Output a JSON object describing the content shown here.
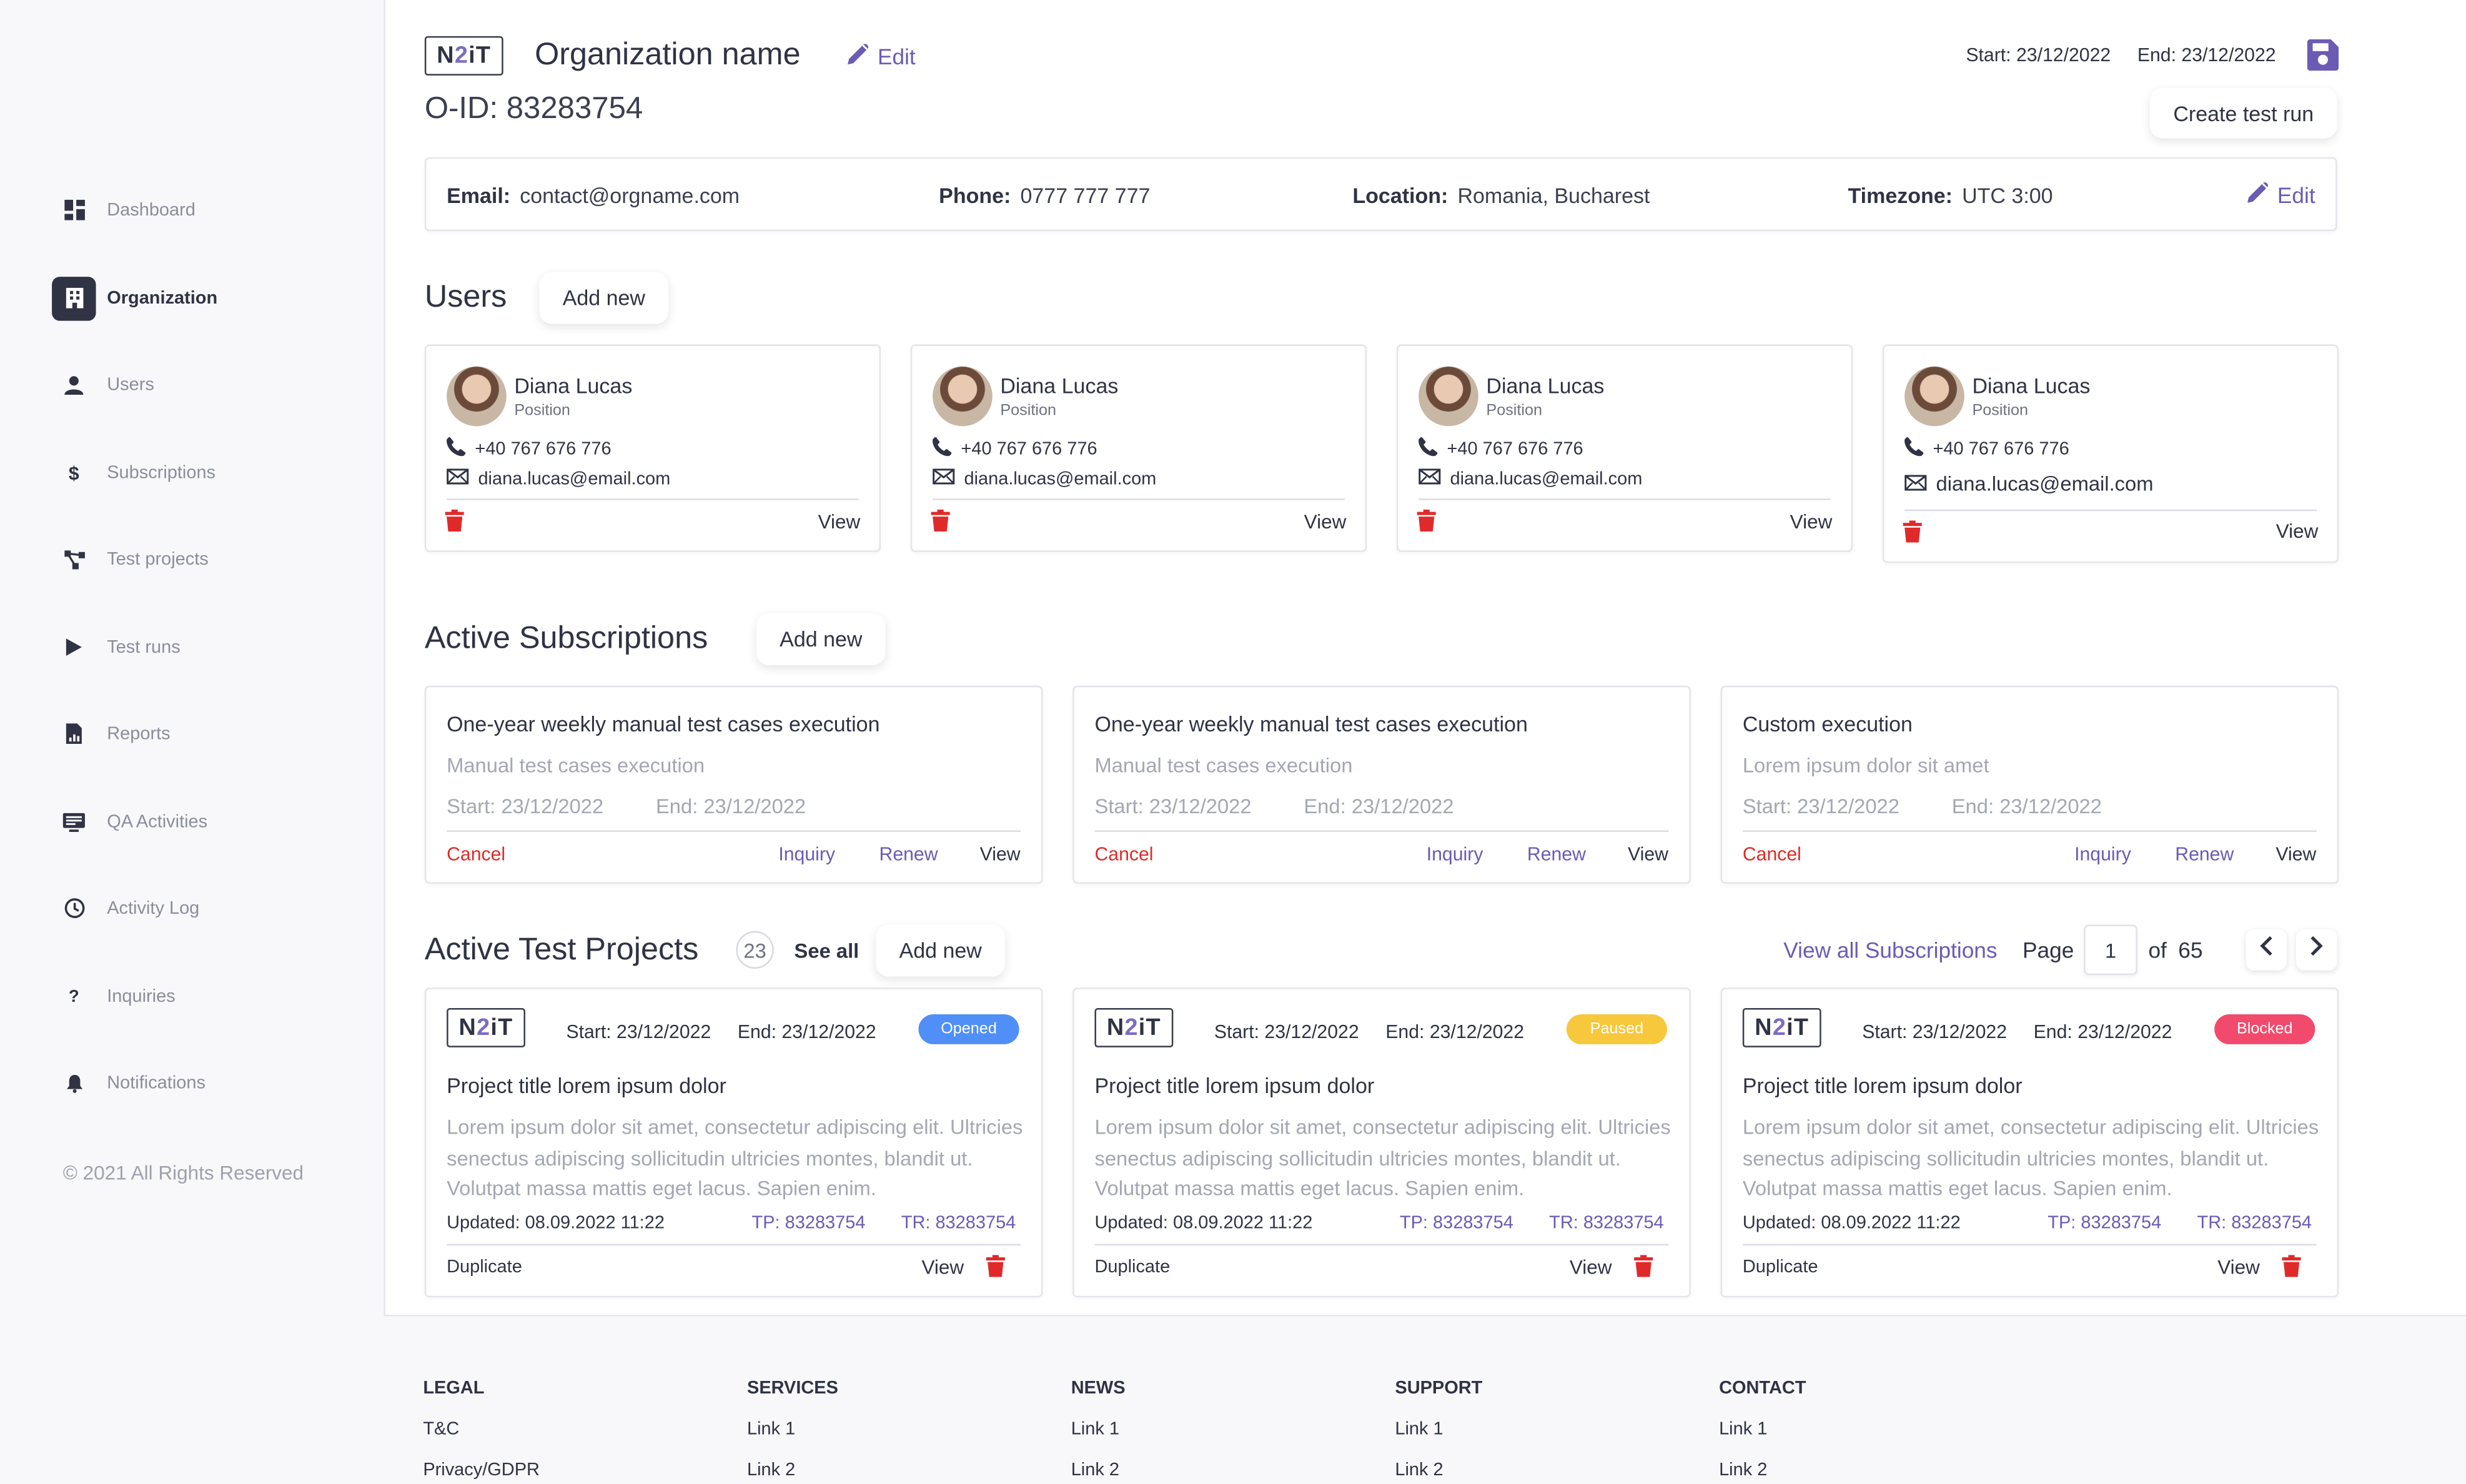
{
  "sidebar": {
    "items": [
      {
        "label": "Dashboard",
        "icon": "dashboard-icon"
      },
      {
        "label": "Organization",
        "icon": "building-icon"
      },
      {
        "label": "Users",
        "icon": "user-icon"
      },
      {
        "label": "Subscriptions",
        "icon": "dollar-icon"
      },
      {
        "label": "Test projects",
        "icon": "project-icon"
      },
      {
        "label": "Test runs",
        "icon": "play-icon"
      },
      {
        "label": "Reports",
        "icon": "report-icon"
      },
      {
        "label": "QA Activities",
        "icon": "qa-icon"
      },
      {
        "label": "Activity Log",
        "icon": "clock-icon"
      },
      {
        "label": "Inquiries",
        "icon": "question-icon"
      },
      {
        "label": "Notifications",
        "icon": "bell-icon"
      }
    ],
    "active": "Organization",
    "copyright": "© 2021 All Rights Reserved"
  },
  "header": {
    "logo_text": "N2iT",
    "org_name": "Organization name",
    "edit_label": "Edit",
    "oid": "O-ID: 83283754",
    "start": "Start: 23/12/2022",
    "end": "End: 23/12/2022",
    "create_test_run": "Create test run"
  },
  "info": {
    "email_label": "Email:",
    "email": "contact@orgname.com",
    "phone_label": "Phone:",
    "phone": "0777 777 777",
    "location_label": "Location:",
    "location": "Romania, Bucharest",
    "timezone_label": "Timezone:",
    "timezone": "UTC 3:00",
    "edit_label": "Edit"
  },
  "users": {
    "title": "Users",
    "add_new": "Add new",
    "cards": [
      {
        "name": "Diana Lucas",
        "position": "Position",
        "phone": "+40 767 676 776",
        "email": "diana.lucas@email.com",
        "view": "View"
      },
      {
        "name": "Diana Lucas",
        "position": "Position",
        "phone": "+40 767 676 776",
        "email": "diana.lucas@email.com",
        "view": "View"
      },
      {
        "name": "Diana Lucas",
        "position": "Position",
        "phone": "+40 767 676 776",
        "email": "diana.lucas@email.com",
        "view": "View"
      },
      {
        "name": "Diana Lucas",
        "position": "Position",
        "phone": "+40 767 676 776",
        "email": "diana.lucas@email.com",
        "view": "View"
      }
    ]
  },
  "subscriptions": {
    "title": "Active Subscriptions",
    "add_new": "Add new",
    "cards": [
      {
        "title": "One-year weekly manual test cases execution",
        "subtitle": "Manual test cases execution",
        "start": "Start: 23/12/2022",
        "end": "End: 23/12/2022",
        "cancel": "Cancel",
        "inquiry": "Inquiry",
        "renew": "Renew",
        "view": "View"
      },
      {
        "title": "One-year weekly manual test cases execution",
        "subtitle": "Manual test cases execution",
        "start": "Start: 23/12/2022",
        "end": "End: 23/12/2022",
        "cancel": "Cancel",
        "inquiry": "Inquiry",
        "renew": "Renew",
        "view": "View"
      },
      {
        "title": "Custom execution",
        "subtitle": "Lorem ipsum dolor sit amet",
        "start": "Start: 23/12/2022",
        "end": "End: 23/12/2022",
        "cancel": "Cancel",
        "inquiry": "Inquiry",
        "renew": "Renew",
        "view": "View"
      }
    ]
  },
  "projects": {
    "title": "Active Test Projects",
    "count": "23",
    "see_all": "See all",
    "add_new": "Add new",
    "view_all_subscriptions": "View all Subscriptions",
    "page_label": "Page",
    "page_value": "1",
    "of_label": "of",
    "total_pages": "65",
    "cards": [
      {
        "start": "Start: 23/12/2022",
        "end": "End: 23/12/2022",
        "status": "Opened",
        "status_color": "#4f8ff7",
        "title": "Project title lorem ipsum dolor",
        "description": "Lorem ipsum dolor sit amet, consectetur adipiscing elit. Ultricies senectus adipiscing sollicitudin ultricies montes, blandit ut. Volutpat massa mattis eget lacus. Sapien enim.",
        "updated": "Updated: 08.09.2022 11:22",
        "tp": "TP: 83283754",
        "tr": "TR: 83283754",
        "duplicate": "Duplicate",
        "view": "View"
      },
      {
        "start": "Start: 23/12/2022",
        "end": "End: 23/12/2022",
        "status": "Paused",
        "status_color": "#f8c83c",
        "title": "Project title lorem ipsum dolor",
        "description": "Lorem ipsum dolor sit amet, consectetur adipiscing elit. Ultricies senectus adipiscing sollicitudin ultricies montes, blandit ut. Volutpat massa mattis eget lacus. Sapien enim.",
        "updated": "Updated: 08.09.2022 11:22",
        "tp": "TP: 83283754",
        "tr": "TR: 83283754",
        "duplicate": "Duplicate",
        "view": "View"
      },
      {
        "start": "Start: 23/12/2022",
        "end": "End: 23/12/2022",
        "status": "Blocked",
        "status_color": "#f24a6c",
        "title": "Project title lorem ipsum dolor",
        "description": "Lorem ipsum dolor sit amet, consectetur adipiscing elit. Ultricies senectus adipiscing sollicitudin ultricies montes, blandit ut. Volutpat massa mattis eget lacus. Sapien enim.",
        "updated": "Updated: 08.09.2022 11:22",
        "tp": "TP: 83283754",
        "tr": "TR: 83283754",
        "duplicate": "Duplicate",
        "view": "View"
      }
    ]
  },
  "footer": {
    "columns": [
      {
        "heading": "LEGAL",
        "links": [
          "T&C",
          "Privacy/GDPR"
        ]
      },
      {
        "heading": "SERVICES",
        "links": [
          "Link 1",
          "Link 2"
        ]
      },
      {
        "heading": "NEWS",
        "links": [
          "Link 1",
          "Link 2"
        ]
      },
      {
        "heading": "SUPPORT",
        "links": [
          "Link 1",
          "Link 2"
        ]
      },
      {
        "heading": "CONTACT",
        "links": [
          "Link 1",
          "Link 2"
        ]
      }
    ]
  },
  "colors": {
    "accent": "#6b5bb5",
    "danger": "#e02a2a",
    "text": "#2f3344"
  }
}
